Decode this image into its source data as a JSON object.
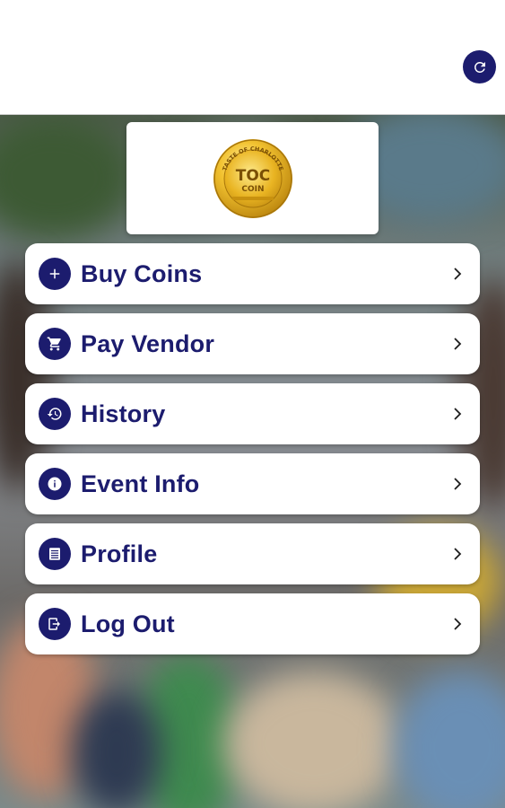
{
  "header": {
    "refresh_icon": "refresh-icon"
  },
  "logo": {
    "ring_text": "TASTE OF CHARLOTTE",
    "line1": "TOC",
    "line2": "COIN"
  },
  "menu": {
    "items": [
      {
        "label": "Buy Coins",
        "icon": "plus-icon"
      },
      {
        "label": "Pay Vendor",
        "icon": "cart-icon"
      },
      {
        "label": "History",
        "icon": "history-icon"
      },
      {
        "label": "Event Info",
        "icon": "info-icon"
      },
      {
        "label": "Profile",
        "icon": "list-icon"
      },
      {
        "label": "Log Out",
        "icon": "logout-icon"
      }
    ]
  },
  "colors": {
    "accent": "#1c1c6e",
    "card": "#ffffff",
    "coin_gold": "#e6b422"
  }
}
